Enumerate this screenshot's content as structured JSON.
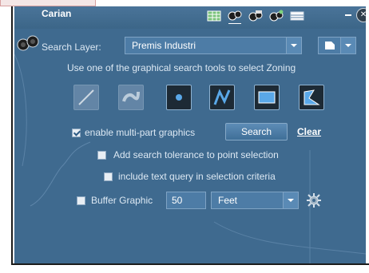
{
  "window": {
    "title": "Carian"
  },
  "header_icons": [
    "table-icon",
    "measure-icon",
    "layers-icon",
    "query-icon",
    "grid-icon"
  ],
  "search_layer": {
    "label": "Search Layer:",
    "selected": "Premis Industri"
  },
  "instruction": "Use one of the graphical search tools to select Zoning",
  "tools": [
    {
      "name": "line-tool",
      "icon": "line-icon",
      "active": false
    },
    {
      "name": "freehand-tool",
      "icon": "freehand-icon",
      "active": false
    },
    {
      "name": "point-tool",
      "icon": "point-icon",
      "active": true
    },
    {
      "name": "polyline-tool",
      "icon": "polyline-icon",
      "active": true
    },
    {
      "name": "rectangle-tool",
      "icon": "rectangle-icon",
      "active": true
    },
    {
      "name": "polygon-tool",
      "icon": "polygon-icon",
      "active": true
    }
  ],
  "multipart": {
    "label": "enable multi-part graphics",
    "checked": true
  },
  "buttons": {
    "search": "Search",
    "clear": "Clear"
  },
  "tolerance": {
    "label": "Add search tolerance to point selection",
    "checked": false
  },
  "text_query": {
    "label": "include text query in selection criteria",
    "checked": false
  },
  "buffer": {
    "label": "Buffer Graphic",
    "checked": false,
    "distance": "50",
    "unit": "Feet"
  },
  "colors": {
    "panel": "#3f6a8f",
    "active_tool": "#1d2a35",
    "accent": "#4d7ca6"
  }
}
